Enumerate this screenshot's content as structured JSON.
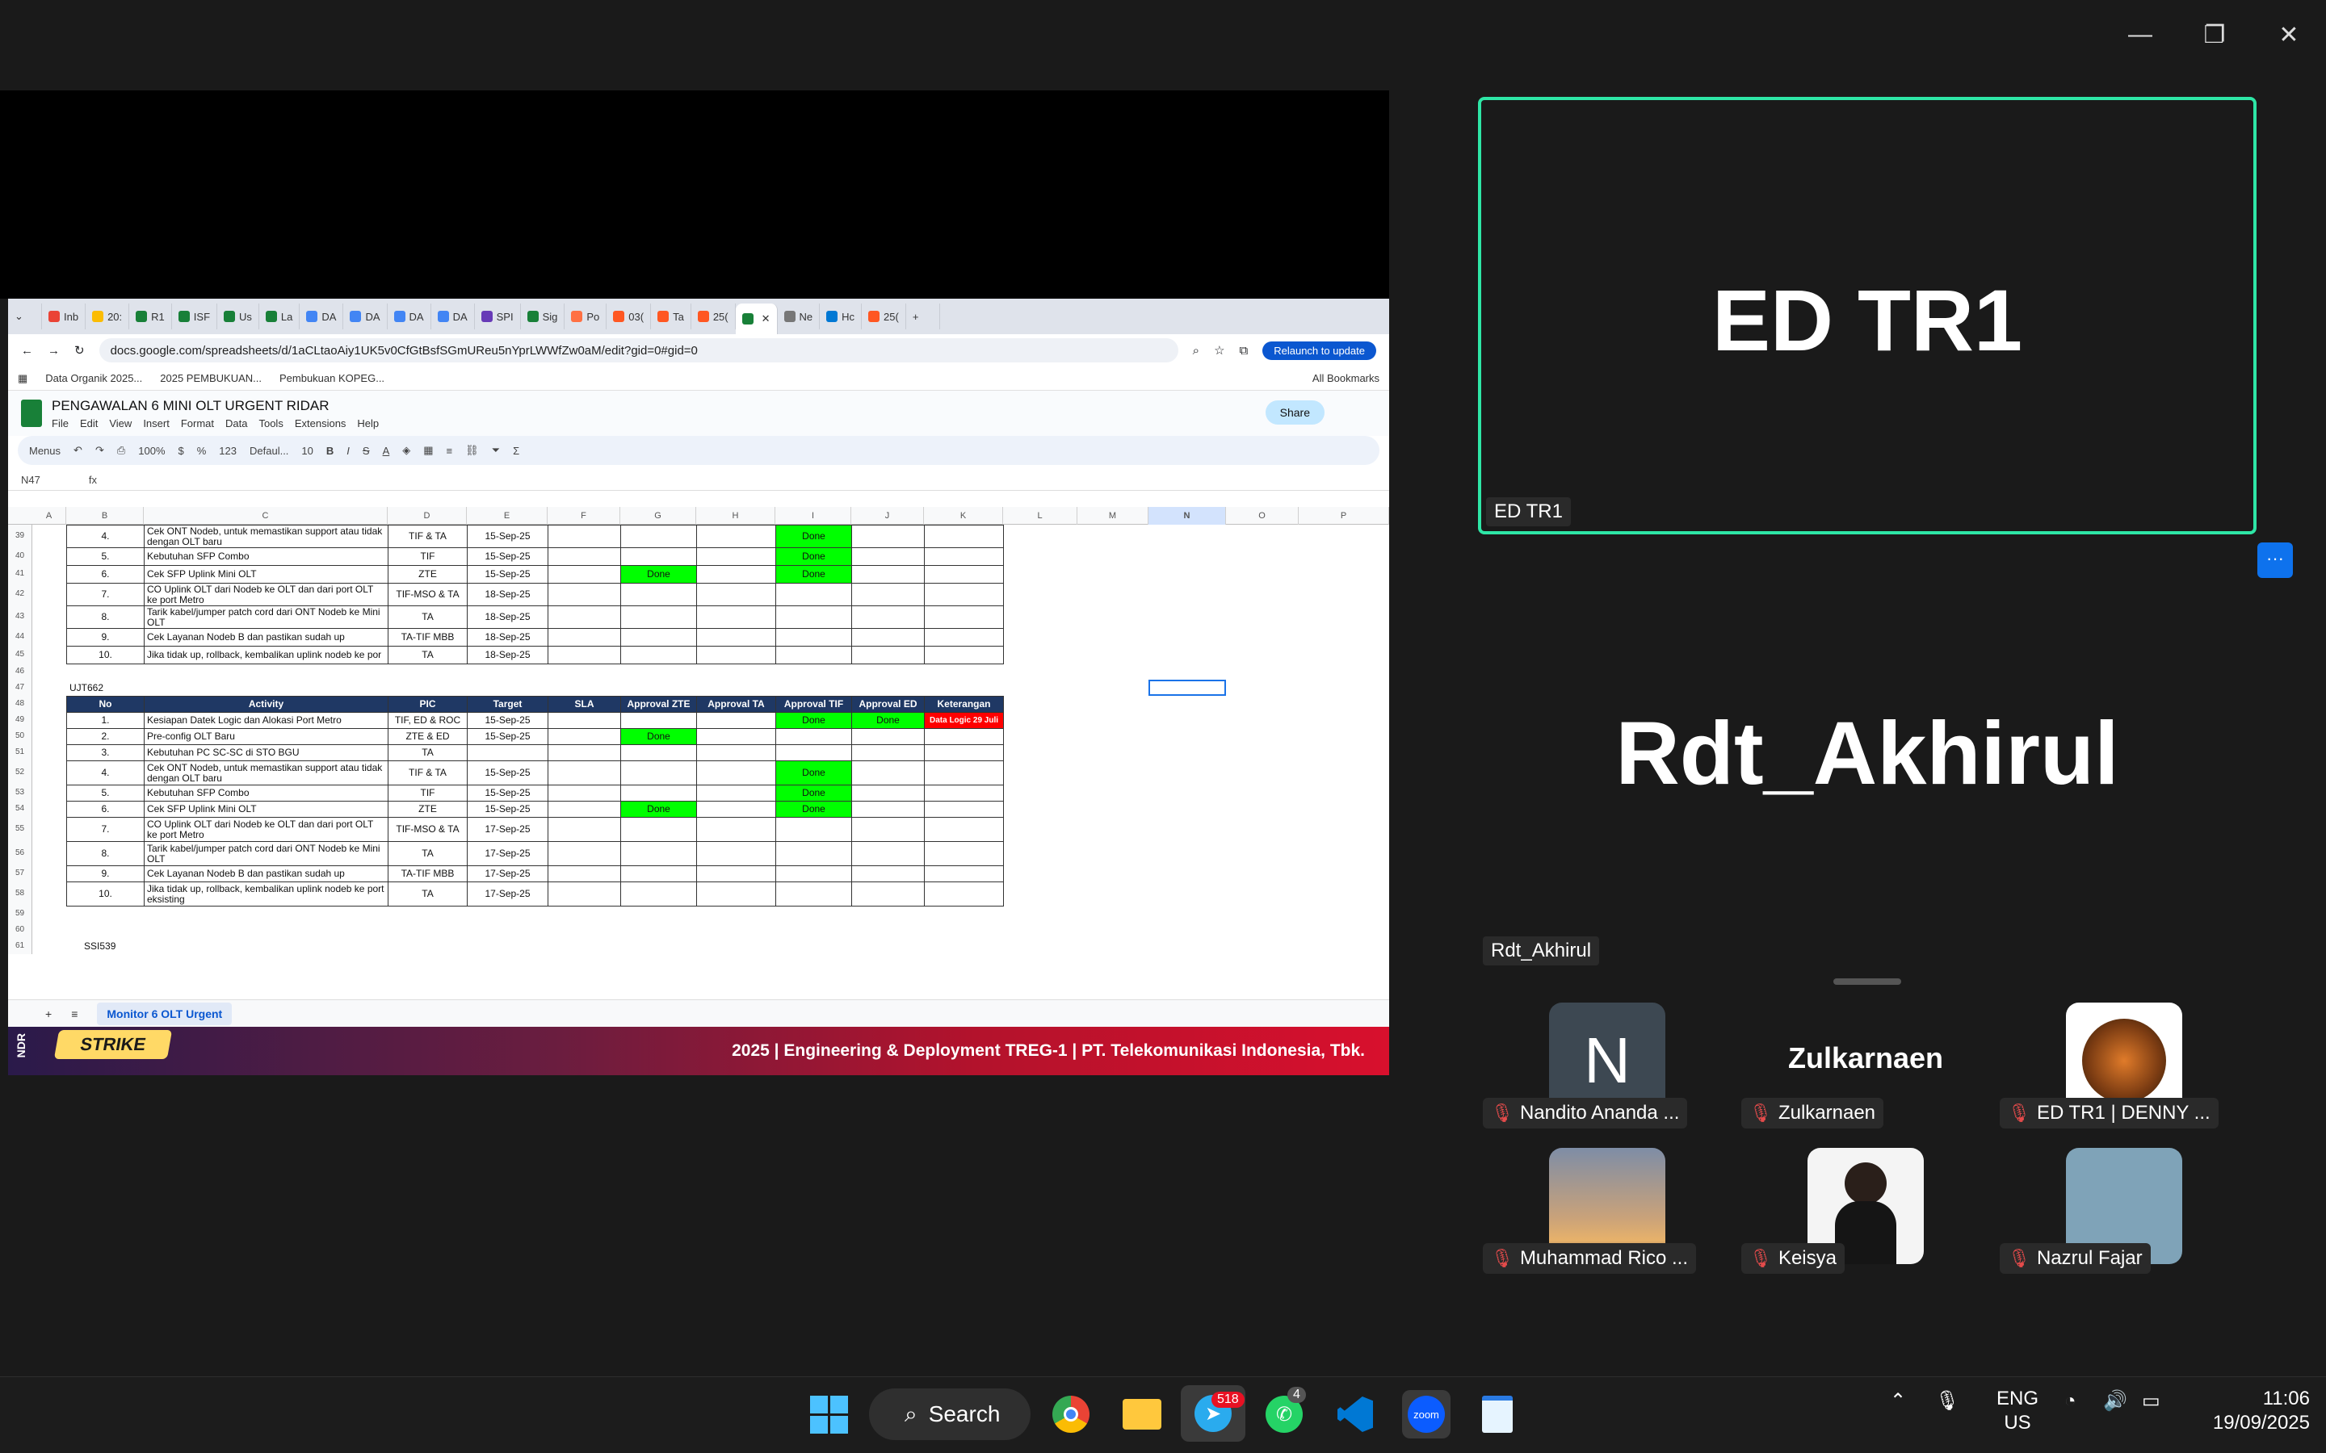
{
  "window_controls": {
    "minimize": "—",
    "restore": "❐",
    "close": "✕"
  },
  "browser": {
    "tabs": [
      "Inb",
      "20:",
      "R1",
      "ISF",
      "Us",
      "La",
      "DA",
      "DA",
      "DA",
      "DA",
      "SPI",
      "Sig",
      "Po",
      "03(",
      "Ta",
      "25(",
      "",
      "Ne",
      "Hc",
      "25("
    ],
    "url": "docs.google.com/spreadsheets/d/1aCLtaoAiy1UK5v0CfGtBsfSGmUReu5nYprLWWfZw0aM/edit?gid=0#gid=0",
    "relaunch": "Relaunch to update",
    "bookmarks": [
      "Data Organik 2025...",
      "2025 PEMBUKUAN...",
      "Pembukuan KOPEG..."
    ],
    "all_bookmarks": "All Bookmarks"
  },
  "sheets": {
    "title": "PENGAWALAN 6 MINI OLT URGENT RIDAR",
    "menu": [
      "File",
      "Edit",
      "View",
      "Insert",
      "Format",
      "Data",
      "Tools",
      "Extensions",
      "Help"
    ],
    "share": "Share",
    "toolbar": {
      "menus": "Menus",
      "zoom": "100%",
      "currency": "$",
      "percent": "%",
      "format123": "123",
      "font": "Defaul...",
      "font_size": "10"
    },
    "cell_ref": "N47",
    "fx": "fx",
    "columns": [
      "A",
      "B",
      "C",
      "D",
      "E",
      "F",
      "G",
      "H",
      "I",
      "J",
      "K",
      "L",
      "M",
      "N",
      "O",
      "P"
    ],
    "sheet_tab": "Monitor 6 OLT Urgent",
    "section2_label": "UJT662",
    "section3_label": "SSI539",
    "headers": [
      "No",
      "Activity",
      "PIC",
      "Target",
      "SLA",
      "Approval ZTE",
      "Approval TA",
      "Approval TIF",
      "Approval ED",
      "Keterangan"
    ],
    "rows_top": [
      {
        "r": "39",
        "no": "4.",
        "act": "Cek ONT Nodeb, untuk memastikan support atau tidak dengan OLT baru",
        "pic": "TIF & TA",
        "tgt": "15-Sep-25",
        "zte": "",
        "tif": "Done",
        "ed": ""
      },
      {
        "r": "40",
        "no": "5.",
        "act": "Kebutuhan SFP Combo",
        "pic": "TIF",
        "tgt": "15-Sep-25",
        "zte": "",
        "tif": "Done",
        "ed": ""
      },
      {
        "r": "41",
        "no": "6.",
        "act": "Cek SFP Uplink Mini OLT",
        "pic": "ZTE",
        "tgt": "15-Sep-25",
        "zte": "Done",
        "tif": "Done",
        "ed": ""
      },
      {
        "r": "42",
        "no": "7.",
        "act": "CO Uplink OLT dari Nodeb ke OLT dan dari port OLT ke port Metro",
        "pic": "TIF-MSO & TA",
        "tgt": "18-Sep-25",
        "zte": "",
        "tif": "",
        "ed": ""
      },
      {
        "r": "43",
        "no": "8.",
        "act": "Tarik kabel/jumper patch cord dari ONT Nodeb ke Mini OLT",
        "pic": "TA",
        "tgt": "18-Sep-25",
        "zte": "",
        "tif": "",
        "ed": ""
      },
      {
        "r": "44",
        "no": "9.",
        "act": "Cek Layanan Nodeb B dan pastikan sudah up",
        "pic": "TA-TIF MBB",
        "tgt": "18-Sep-25",
        "zte": "",
        "tif": "",
        "ed": ""
      },
      {
        "r": "45",
        "no": "10.",
        "act": "Jika tidak up, rollback, kembalikan uplink nodeb ke por",
        "pic": "TA",
        "tgt": "18-Sep-25",
        "zte": "",
        "tif": "",
        "ed": ""
      }
    ],
    "rows_bottom": [
      {
        "r": "49",
        "no": "1.",
        "act": "Kesiapan Datek Logic dan Alokasi Port Metro",
        "pic": "TIF, ED & ROC",
        "tgt": "15-Sep-25",
        "zte": "",
        "tif": "Done",
        "ed": "Done",
        "ket": "Data Logic 29 Juli"
      },
      {
        "r": "50",
        "no": "2.",
        "act": "Pre-config OLT Baru",
        "pic": "ZTE & ED",
        "tgt": "15-Sep-25",
        "zte": "Done",
        "tif": "",
        "ed": "",
        "ket": ""
      },
      {
        "r": "51",
        "no": "3.",
        "act": "Kebutuhan PC SC-SC di STO BGU",
        "pic": "TA",
        "tgt": "",
        "zte": "",
        "tif": "",
        "ed": "",
        "ket": ""
      },
      {
        "r": "52",
        "no": "4.",
        "act": "Cek ONT Nodeb, untuk memastikan support atau tidak dengan OLT baru",
        "pic": "TIF & TA",
        "tgt": "15-Sep-25",
        "zte": "",
        "tif": "Done",
        "ed": "",
        "ket": ""
      },
      {
        "r": "53",
        "no": "5.",
        "act": "Kebutuhan SFP Combo",
        "pic": "TIF",
        "tgt": "15-Sep-25",
        "zte": "",
        "tif": "Done",
        "ed": "",
        "ket": ""
      },
      {
        "r": "54",
        "no": "6.",
        "act": "Cek SFP Uplink Mini OLT",
        "pic": "ZTE",
        "tgt": "15-Sep-25",
        "zte": "Done",
        "tif": "Done",
        "ed": "",
        "ket": ""
      },
      {
        "r": "55",
        "no": "7.",
        "act": "CO Uplink OLT dari Nodeb ke OLT dan dari port OLT ke port Metro",
        "pic": "TIF-MSO & TA",
        "tgt": "17-Sep-25",
        "zte": "",
        "tif": "",
        "ed": "",
        "ket": ""
      },
      {
        "r": "56",
        "no": "8.",
        "act": "Tarik kabel/jumper patch cord dari ONT Nodeb ke Mini OLT",
        "pic": "TA",
        "tgt": "17-Sep-25",
        "zte": "",
        "tif": "",
        "ed": "",
        "ket": ""
      },
      {
        "r": "57",
        "no": "9.",
        "act": "Cek Layanan Nodeb B dan pastikan sudah up",
        "pic": "TA-TIF MBB",
        "tgt": "17-Sep-25",
        "zte": "",
        "tif": "",
        "ed": "",
        "ket": ""
      },
      {
        "r": "58",
        "no": "10.",
        "act": "Jika tidak up, rollback, kembalikan uplink nodeb ke port eksisting",
        "pic": "TA",
        "tgt": "17-Sep-25",
        "zte": "",
        "tif": "",
        "ed": "",
        "ket": ""
      }
    ],
    "extra_rows": [
      "46",
      "47",
      "48",
      "59",
      "60",
      "61"
    ]
  },
  "banner": {
    "text": "2025 | Engineering & Deployment TREG-1 | PT. Telekomunikasi Indonesia, Tbk.",
    "logo": "STRIKE",
    "side": "NDR"
  },
  "zoom": {
    "main_tile_name": "ED TR1",
    "main_tile_label": "ED TR1",
    "more": "···",
    "active_speaker": "Rdt_Akhirul",
    "active_speaker_label": "Rdt_Akhirul",
    "participants": [
      {
        "name": "Nandito Ananda ...",
        "avatar_letter": "N"
      },
      {
        "name": "Zulkarnaen",
        "title_text": "Zulkarnaen"
      },
      {
        "name": "ED TR1 | DENNY ..."
      },
      {
        "name": "Muhammad Rico ..."
      },
      {
        "name": "Keisya"
      },
      {
        "name": "Nazrul Fajar"
      }
    ]
  },
  "taskbar": {
    "search": "Search",
    "telegram_badge": "518",
    "whatsapp_badge": "4",
    "zoom_label": "zoom",
    "lang_top": "ENG",
    "lang_bottom": "US",
    "time": "11:06",
    "date": "19/09/2025"
  },
  "colors": {
    "accent_green": "#2ee6a6",
    "cell_green": "#00ff00",
    "header_navy": "#1f3864",
    "zoom_blue": "#0e72ed"
  }
}
